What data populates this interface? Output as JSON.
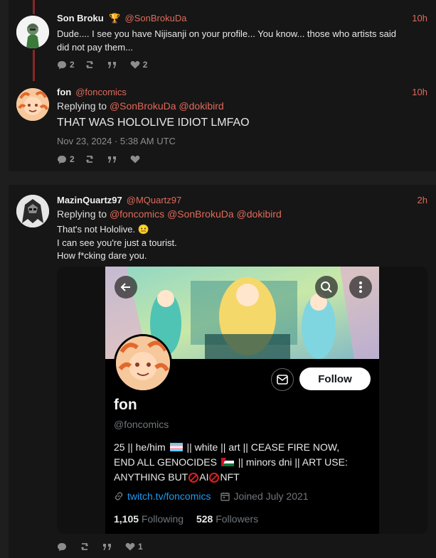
{
  "posts": [
    {
      "username": "Son Broku",
      "badge": "🏆",
      "handle": "@SonBrokuDa",
      "time": "10h",
      "lines": [
        "Dude.... I see you have Nijisanji on your profile... You know... those who artists said",
        "did not pay them..."
      ],
      "stats": {
        "replies": "2",
        "retweets": "",
        "quotes": "",
        "likes": "2"
      }
    },
    {
      "username": "fon",
      "handle": "@foncomics",
      "time": "10h",
      "replying_prefix": "Replying to",
      "replying_to": [
        "@SonBrokuDa",
        "@dokibird"
      ],
      "text": "THAT WAS HOLOLIVE IDIOT LMFAO",
      "date": "Nov 23, 2024 · 5:38 AM UTC",
      "stats": {
        "replies": "2",
        "retweets": "",
        "quotes": "",
        "likes": ""
      }
    },
    {
      "username": "MazinQuartz97",
      "handle": "@MQuartz97",
      "time": "2h",
      "replying_prefix": "Replying to",
      "replying_to": [
        "@foncomics",
        "@SonBrokuDa",
        "@dokibird"
      ],
      "lines": [
        "That's not Hololive. 😐",
        "I can see you're just a tourist.",
        "How f*cking dare you."
      ],
      "stats": {
        "replies": "",
        "retweets": "",
        "quotes": "",
        "likes": "1"
      }
    }
  ],
  "embedded_profile": {
    "name": "fon",
    "handle": "@foncomics",
    "follow_label": "Follow",
    "bio": {
      "l1a": "25 || he/him",
      "l1b": "|| white || art || CEASE FIRE NOW,",
      "l2a": "END ALL GENOCIDES",
      "l2b": "|| minors dni || ART USE:",
      "l3a": "ANYTHING BUT",
      "l3b": "AI",
      "l3c": "NFT"
    },
    "link": "twitch.tv/foncomics",
    "joined": "Joined July 2021",
    "following_count": "1,105",
    "following_label": "Following",
    "followers_count": "528",
    "followers_label": "Followers"
  },
  "colors": {
    "accent": "#e06a5a",
    "thread_line": "#8a2626",
    "link_blue": "#1d9bf0"
  }
}
